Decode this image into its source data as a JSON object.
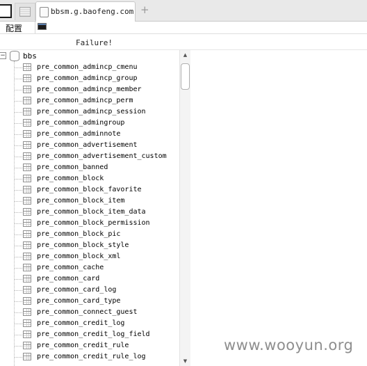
{
  "tabs": {
    "active_title": "bbsm.g.baofeng.com",
    "new_tab_symbol": "+"
  },
  "toolbar": {
    "config_label": "配置",
    "console_icon": "command-prompt-icon"
  },
  "status": {
    "message": "Failure!"
  },
  "tree": {
    "root": {
      "label": "bbs",
      "expander": "−",
      "icon": "database-icon"
    },
    "table_icon": "table-icon",
    "items": [
      {
        "label": "pre_common_admincp_cmenu"
      },
      {
        "label": "pre_common_admincp_group"
      },
      {
        "label": "pre_common_admincp_member"
      },
      {
        "label": "pre_common_admincp_perm"
      },
      {
        "label": "pre_common_admincp_session"
      },
      {
        "label": "pre_common_admingroup"
      },
      {
        "label": "pre_common_adminnote"
      },
      {
        "label": "pre_common_advertisement"
      },
      {
        "label": "pre_common_advertisement_custom"
      },
      {
        "label": "pre_common_banned"
      },
      {
        "label": "pre_common_block"
      },
      {
        "label": "pre_common_block_favorite"
      },
      {
        "label": "pre_common_block_item"
      },
      {
        "label": "pre_common_block_item_data"
      },
      {
        "label": "pre_common_block_permission"
      },
      {
        "label": "pre_common_block_pic"
      },
      {
        "label": "pre_common_block_style"
      },
      {
        "label": "pre_common_block_xml"
      },
      {
        "label": "pre_common_cache"
      },
      {
        "label": "pre_common_card"
      },
      {
        "label": "pre_common_card_log"
      },
      {
        "label": "pre_common_card_type"
      },
      {
        "label": "pre_common_connect_guest"
      },
      {
        "label": "pre_common_credit_log"
      },
      {
        "label": "pre_common_credit_log_field"
      },
      {
        "label": "pre_common_credit_rule"
      },
      {
        "label": "pre_common_credit_rule_log"
      }
    ]
  },
  "scrollbar": {
    "up_arrow": "▲",
    "down_arrow": "▼"
  },
  "watermark": {
    "text": "www.wooyun.org"
  }
}
